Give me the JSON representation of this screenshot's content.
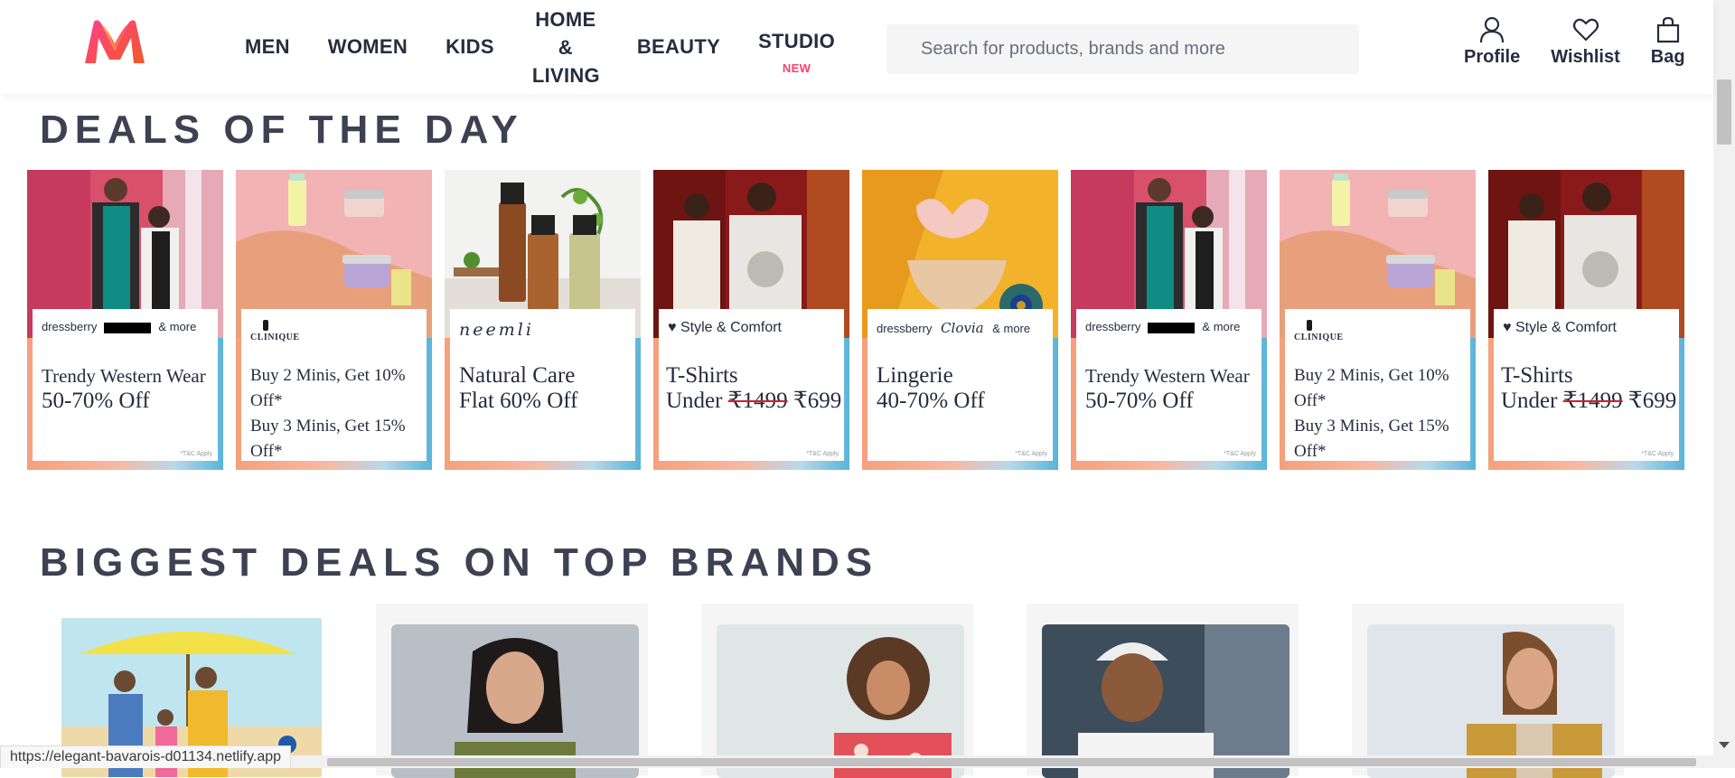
{
  "header": {
    "nav": [
      {
        "label": "MEN"
      },
      {
        "label": "WOMEN"
      },
      {
        "label": "KIDS"
      },
      {
        "label": "HOME & LIVING",
        "lines": [
          "HOME",
          "&",
          "LIVING"
        ]
      },
      {
        "label": "BEAUTY"
      },
      {
        "label": "STUDIO",
        "badge": "NEW"
      }
    ],
    "search_placeholder": "Search for products, brands and more",
    "actions": {
      "profile": "Profile",
      "wishlist": "Wishlist",
      "bag": "Bag"
    }
  },
  "deals_section": {
    "title": "DEALS OF THE DAY",
    "cards": [
      {
        "brand": "dressberry",
        "brand_2": "& more",
        "title_1": "Trendy Western Wear",
        "title_2": "50-70% Off",
        "tc": "*T&C Apply",
        "photo": "women-fashion-photo"
      },
      {
        "brand": "CLINIQUE",
        "title_1": "Buy 2 Minis, Get 10% Off*",
        "title_2": "Buy 3 Minis, Get 15% Off*",
        "tc": "",
        "photo": "skincare-photo"
      },
      {
        "brand": "neemli",
        "title_1": "Natural Care",
        "title_2": "Flat 60% Off",
        "tc": "",
        "photo": "serum-photo"
      },
      {
        "brand": "Style & Comfort",
        "title_1": "T-Shirts",
        "title_2a": "Under ",
        "title_strike": "₹1499",
        "title_2b": " ₹699",
        "tc": "*T&C Apply",
        "photo": "men-tshirt-photo"
      },
      {
        "brand": "dressberry",
        "brand_2": "Clovia",
        "brand_3": "& more",
        "title_1": "Lingerie",
        "title_2": "40-70% Off",
        "tc": "*T&C Apply",
        "photo": "lingerie-photo"
      },
      {
        "brand": "dressberry",
        "brand_2": "& more",
        "title_1": "Trendy Western Wear",
        "title_2": "50-70% Off",
        "tc": "*T&C Apply",
        "photo": "women-fashion-photo"
      },
      {
        "brand": "CLINIQUE",
        "title_1": "Buy 2 Minis, Get 10% Off*",
        "title_2": "Buy 3 Minis, Get 15% Off*",
        "tc": "",
        "photo": "skincare-photo"
      },
      {
        "brand": "Style & Comfort",
        "title_1": "T-Shirts",
        "title_2a": "Under ",
        "title_strike": "₹1499",
        "title_2b": " ₹699",
        "tc": "*T&C Apply",
        "photo": "men-tshirt-photo"
      }
    ]
  },
  "brands_section": {
    "title": "BIGGEST DEALS ON TOP BRANDS"
  },
  "status_url": "https://elegant-bavarois-d01134.netlify.app",
  "colors": {
    "accent": "#ff3f6c",
    "text": "#282c3f",
    "heading": "#3e4152",
    "search_bg": "#f5f5f6"
  }
}
